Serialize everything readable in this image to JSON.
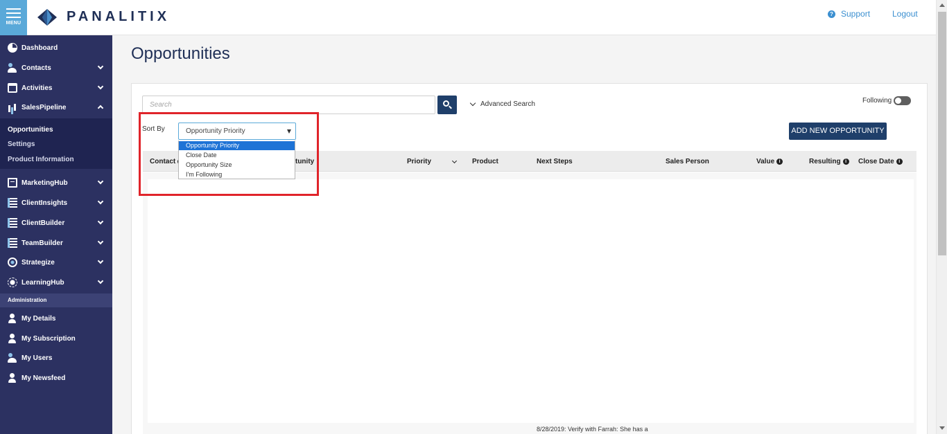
{
  "header": {
    "menu_label": "MENU",
    "logo_text": "PANALITIX",
    "support_label": "Support",
    "logout_label": "Logout"
  },
  "sidebar": {
    "items": [
      {
        "label": "Dashboard",
        "icon": "dashboard-icon"
      },
      {
        "label": "Contacts",
        "icon": "contacts-icon"
      },
      {
        "label": "Activities",
        "icon": "activities-icon"
      },
      {
        "label": "SalesPipeline",
        "icon": "sales-pipeline-icon"
      },
      {
        "label": "MarketingHub",
        "icon": "marketing-hub-icon"
      },
      {
        "label": "ClientInsights",
        "icon": "client-insights-icon"
      },
      {
        "label": "ClientBuilder",
        "icon": "client-builder-icon"
      },
      {
        "label": "TeamBuilder",
        "icon": "team-builder-icon"
      },
      {
        "label": "Strategize",
        "icon": "strategize-icon"
      },
      {
        "label": "LearningHub",
        "icon": "learning-hub-icon"
      }
    ],
    "sub_items": [
      "Opportunities",
      "Settings",
      "Product Information"
    ],
    "admin_header": "Administration",
    "admin_items": [
      {
        "label": "My Details",
        "icon": "user-info-icon"
      },
      {
        "label": "My Subscription",
        "icon": "user-subscription-icon"
      },
      {
        "label": "My Users",
        "icon": "users-icon"
      },
      {
        "label": "My Newsfeed",
        "icon": "user-newsfeed-icon"
      }
    ]
  },
  "main": {
    "title": "Opportunities",
    "search_placeholder": "Search",
    "advanced_search_label": "Advanced Search",
    "following_label": "Following",
    "following_on": false,
    "sort_label": "Sort By",
    "sort_value": "Opportunity Priority",
    "sort_options": [
      "Opportunity Priority",
      "Close Date",
      "Opportunity Size",
      "I'm Following"
    ],
    "add_button_label": "ADD NEW OPPORTUNITY",
    "columns": {
      "contact": "Contact",
      "opportunity": "Opportunity",
      "priority": "Priority",
      "product": "Product",
      "next_steps": "Next Steps",
      "sales_person": "Sales Person",
      "value": "Value",
      "resulting": "Resulting",
      "close_date": "Close Date"
    },
    "partial_row": {
      "next_steps": "8/28/2019: Verify with Farrah: She has a"
    }
  },
  "colors": {
    "sidebar_bg": "#2c3161",
    "primary_button": "#1f3f6a",
    "link": "#3b8fd0",
    "highlight_box": "#e0242a",
    "selected_option": "#1e73d6"
  }
}
